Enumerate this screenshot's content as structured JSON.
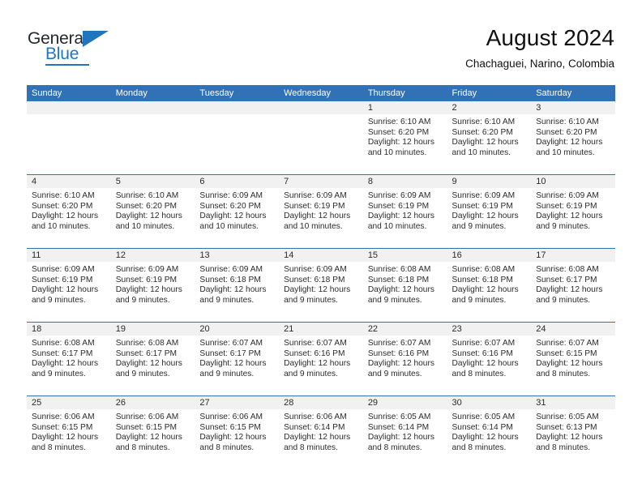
{
  "brand": {
    "name_top": "General",
    "name_bottom": "Blue",
    "accent_color": "#2175be",
    "triangle_icon": "triangle-icon"
  },
  "header": {
    "title": "August 2024",
    "subtitle": "Chachaguei, Narino, Colombia"
  },
  "calendar": {
    "header_bg": "#3072b5",
    "daynum_band_bg": "#f1f1f1",
    "weekday_headers": [
      "Sunday",
      "Monday",
      "Tuesday",
      "Wednesday",
      "Thursday",
      "Friday",
      "Saturday"
    ],
    "weeks": [
      [
        {
          "day": "",
          "text": ""
        },
        {
          "day": "",
          "text": ""
        },
        {
          "day": "",
          "text": ""
        },
        {
          "day": "",
          "text": ""
        },
        {
          "day": "1",
          "text": "Sunrise: 6:10 AM\nSunset: 6:20 PM\nDaylight: 12 hours\nand 10 minutes."
        },
        {
          "day": "2",
          "text": "Sunrise: 6:10 AM\nSunset: 6:20 PM\nDaylight: 12 hours\nand 10 minutes."
        },
        {
          "day": "3",
          "text": "Sunrise: 6:10 AM\nSunset: 6:20 PM\nDaylight: 12 hours\nand 10 minutes."
        }
      ],
      [
        {
          "day": "4",
          "text": "Sunrise: 6:10 AM\nSunset: 6:20 PM\nDaylight: 12 hours\nand 10 minutes."
        },
        {
          "day": "5",
          "text": "Sunrise: 6:10 AM\nSunset: 6:20 PM\nDaylight: 12 hours\nand 10 minutes."
        },
        {
          "day": "6",
          "text": "Sunrise: 6:09 AM\nSunset: 6:20 PM\nDaylight: 12 hours\nand 10 minutes."
        },
        {
          "day": "7",
          "text": "Sunrise: 6:09 AM\nSunset: 6:19 PM\nDaylight: 12 hours\nand 10 minutes."
        },
        {
          "day": "8",
          "text": "Sunrise: 6:09 AM\nSunset: 6:19 PM\nDaylight: 12 hours\nand 10 minutes."
        },
        {
          "day": "9",
          "text": "Sunrise: 6:09 AM\nSunset: 6:19 PM\nDaylight: 12 hours\nand 9 minutes."
        },
        {
          "day": "10",
          "text": "Sunrise: 6:09 AM\nSunset: 6:19 PM\nDaylight: 12 hours\nand 9 minutes."
        }
      ],
      [
        {
          "day": "11",
          "text": "Sunrise: 6:09 AM\nSunset: 6:19 PM\nDaylight: 12 hours\nand 9 minutes."
        },
        {
          "day": "12",
          "text": "Sunrise: 6:09 AM\nSunset: 6:19 PM\nDaylight: 12 hours\nand 9 minutes."
        },
        {
          "day": "13",
          "text": "Sunrise: 6:09 AM\nSunset: 6:18 PM\nDaylight: 12 hours\nand 9 minutes."
        },
        {
          "day": "14",
          "text": "Sunrise: 6:09 AM\nSunset: 6:18 PM\nDaylight: 12 hours\nand 9 minutes."
        },
        {
          "day": "15",
          "text": "Sunrise: 6:08 AM\nSunset: 6:18 PM\nDaylight: 12 hours\nand 9 minutes."
        },
        {
          "day": "16",
          "text": "Sunrise: 6:08 AM\nSunset: 6:18 PM\nDaylight: 12 hours\nand 9 minutes."
        },
        {
          "day": "17",
          "text": "Sunrise: 6:08 AM\nSunset: 6:17 PM\nDaylight: 12 hours\nand 9 minutes."
        }
      ],
      [
        {
          "day": "18",
          "text": "Sunrise: 6:08 AM\nSunset: 6:17 PM\nDaylight: 12 hours\nand 9 minutes."
        },
        {
          "day": "19",
          "text": "Sunrise: 6:08 AM\nSunset: 6:17 PM\nDaylight: 12 hours\nand 9 minutes."
        },
        {
          "day": "20",
          "text": "Sunrise: 6:07 AM\nSunset: 6:17 PM\nDaylight: 12 hours\nand 9 minutes."
        },
        {
          "day": "21",
          "text": "Sunrise: 6:07 AM\nSunset: 6:16 PM\nDaylight: 12 hours\nand 9 minutes."
        },
        {
          "day": "22",
          "text": "Sunrise: 6:07 AM\nSunset: 6:16 PM\nDaylight: 12 hours\nand 9 minutes."
        },
        {
          "day": "23",
          "text": "Sunrise: 6:07 AM\nSunset: 6:16 PM\nDaylight: 12 hours\nand 8 minutes."
        },
        {
          "day": "24",
          "text": "Sunrise: 6:07 AM\nSunset: 6:15 PM\nDaylight: 12 hours\nand 8 minutes."
        }
      ],
      [
        {
          "day": "25",
          "text": "Sunrise: 6:06 AM\nSunset: 6:15 PM\nDaylight: 12 hours\nand 8 minutes."
        },
        {
          "day": "26",
          "text": "Sunrise: 6:06 AM\nSunset: 6:15 PM\nDaylight: 12 hours\nand 8 minutes."
        },
        {
          "day": "27",
          "text": "Sunrise: 6:06 AM\nSunset: 6:15 PM\nDaylight: 12 hours\nand 8 minutes."
        },
        {
          "day": "28",
          "text": "Sunrise: 6:06 AM\nSunset: 6:14 PM\nDaylight: 12 hours\nand 8 minutes."
        },
        {
          "day": "29",
          "text": "Sunrise: 6:05 AM\nSunset: 6:14 PM\nDaylight: 12 hours\nand 8 minutes."
        },
        {
          "day": "30",
          "text": "Sunrise: 6:05 AM\nSunset: 6:14 PM\nDaylight: 12 hours\nand 8 minutes."
        },
        {
          "day": "31",
          "text": "Sunrise: 6:05 AM\nSunset: 6:13 PM\nDaylight: 12 hours\nand 8 minutes."
        }
      ]
    ]
  }
}
